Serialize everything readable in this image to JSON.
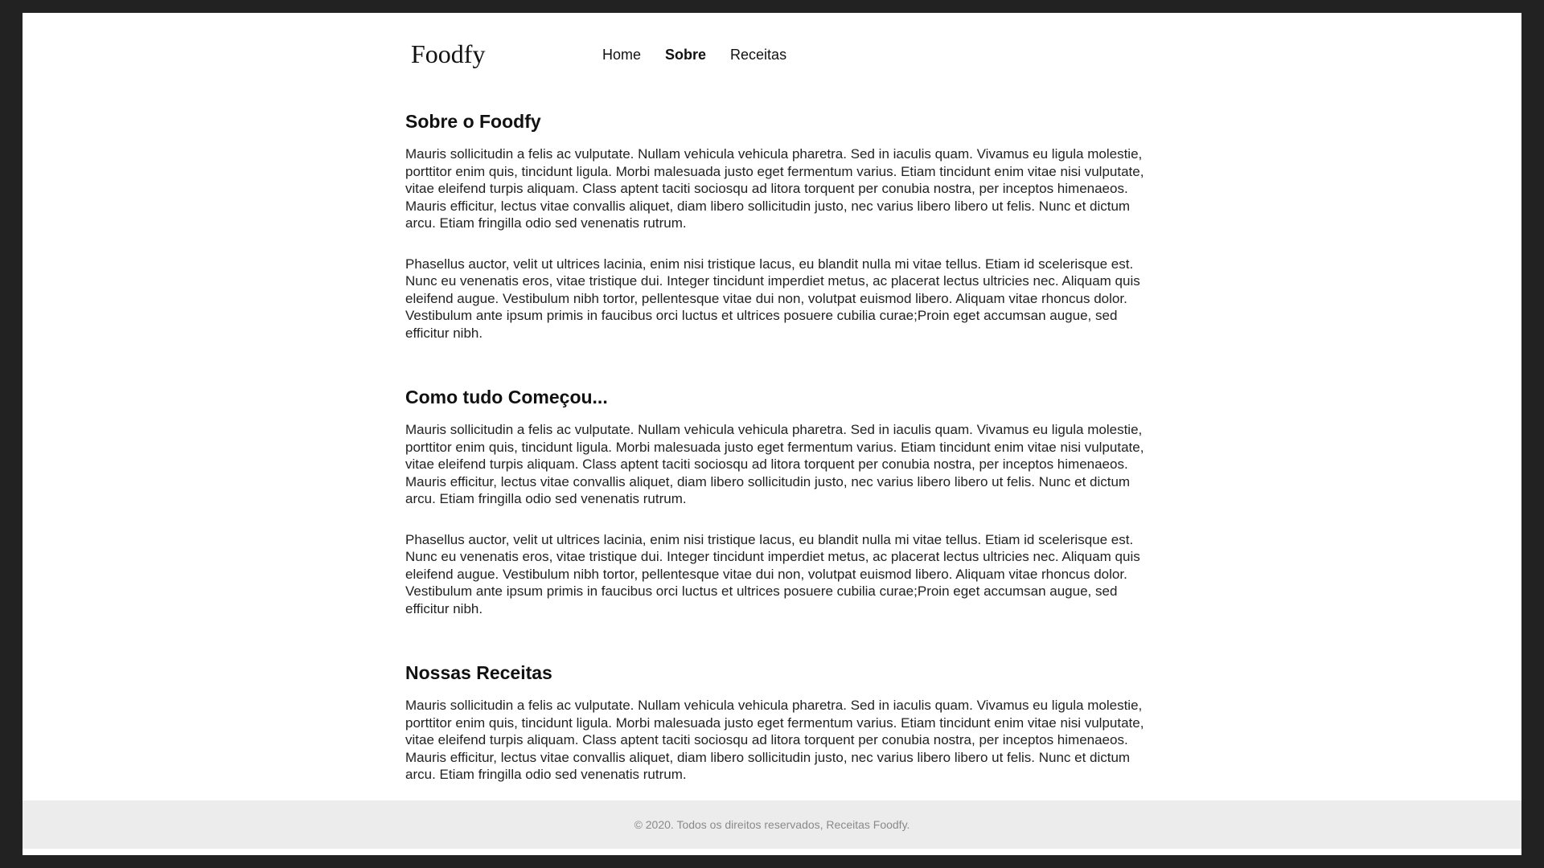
{
  "header": {
    "logo": "Foodfy",
    "nav": {
      "home": "Home",
      "sobre": "Sobre",
      "receitas": "Receitas"
    }
  },
  "sections": [
    {
      "title": "Sobre o Foodfy",
      "paragraphs": [
        "Mauris sollicitudin a felis ac vulputate. Nullam vehicula vehicula pharetra. Sed in iaculis quam. Vivamus eu ligula molestie, porttitor enim quis, tincidunt ligula. Morbi malesuada justo eget fermentum varius. Etiam tincidunt enim vitae nisi vulputate, vitae eleifend turpis aliquam. Class aptent taciti sociosqu ad litora torquent per conubia nostra, per inceptos himenaeos. Mauris efficitur, lectus vitae convallis aliquet, diam libero sollicitudin justo, nec varius libero libero ut felis. Nunc et dictum arcu. Etiam fringilla odio sed venenatis rutrum.",
        "Phasellus auctor, velit ut ultrices lacinia, enim nisi tristique lacus, eu blandit nulla mi vitae tellus. Etiam id scelerisque est. Nunc eu venenatis eros, vitae tristique dui. Integer tincidunt imperdiet metus, ac placerat lectus ultricies nec. Aliquam quis eleifend augue. Vestibulum nibh tortor, pellentesque vitae dui non, volutpat euismod libero. Aliquam vitae rhoncus dolor. Vestibulum ante ipsum primis in faucibus orci luctus et ultrices posuere cubilia curae;Proin eget accumsan augue, sed efficitur nibh."
      ]
    },
    {
      "title": "Como tudo Começou...",
      "paragraphs": [
        "Mauris sollicitudin a felis ac vulputate. Nullam vehicula vehicula pharetra. Sed in iaculis quam. Vivamus eu ligula molestie, porttitor enim quis, tincidunt ligula. Morbi malesuada justo eget fermentum varius. Etiam tincidunt enim vitae nisi vulputate, vitae eleifend turpis aliquam. Class aptent taciti sociosqu ad litora torquent per conubia nostra, per inceptos himenaeos. Mauris efficitur, lectus vitae convallis aliquet, diam libero sollicitudin justo, nec varius libero libero ut felis. Nunc et dictum arcu. Etiam fringilla odio sed venenatis rutrum.",
        "Phasellus auctor, velit ut ultrices lacinia, enim nisi tristique lacus, eu blandit nulla mi vitae tellus. Etiam id scelerisque est. Nunc eu venenatis eros, vitae tristique dui. Integer tincidunt imperdiet metus, ac placerat lectus ultricies nec. Aliquam quis eleifend augue. Vestibulum nibh tortor, pellentesque vitae dui non, volutpat euismod libero. Aliquam vitae rhoncus dolor. Vestibulum ante ipsum primis in faucibus orci luctus et ultrices posuere cubilia curae;Proin eget accumsan augue, sed efficitur nibh."
      ]
    },
    {
      "title": "Nossas Receitas",
      "paragraphs": [
        "Mauris sollicitudin a felis ac vulputate. Nullam vehicula vehicula pharetra. Sed in iaculis quam. Vivamus eu ligula molestie, porttitor enim quis, tincidunt ligula. Morbi malesuada justo eget fermentum varius. Etiam tincidunt enim vitae nisi vulputate, vitae eleifend turpis aliquam. Class aptent taciti sociosqu ad litora torquent per conubia nostra, per inceptos himenaeos. Mauris efficitur, lectus vitae convallis aliquet, diam libero sollicitudin justo, nec varius libero libero ut felis. Nunc et dictum arcu. Etiam fringilla odio sed venenatis rutrum."
      ]
    }
  ],
  "footer": {
    "text": "© 2020. Todos os direitos reservados, Receitas Foodfy."
  }
}
